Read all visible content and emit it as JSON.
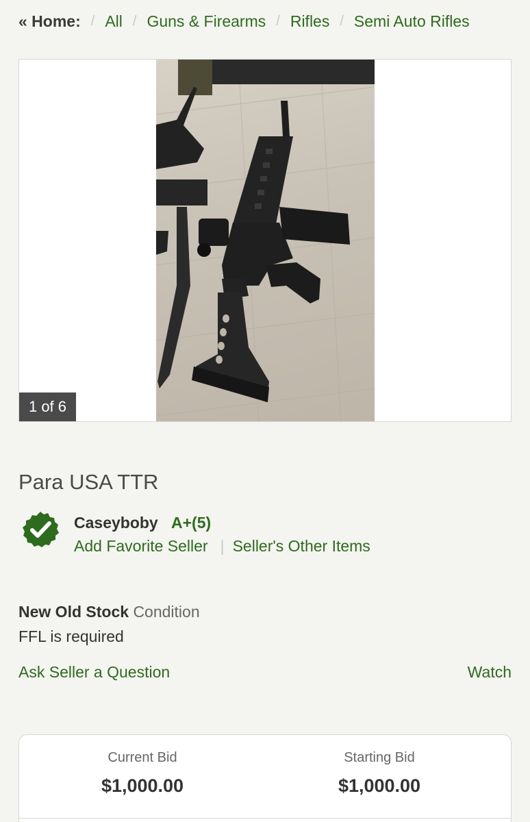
{
  "breadcrumb": {
    "home": "« Home:",
    "items": [
      "All",
      "Guns & Firearms",
      "Rifles",
      "Semi Auto Rifles"
    ],
    "separator": "/"
  },
  "gallery": {
    "counter": "1 of 6"
  },
  "listing": {
    "title": "Para USA TTR"
  },
  "seller": {
    "name": "Caseyboby",
    "rating": "A+(5)",
    "add_favorite": "Add Favorite Seller",
    "other_items": "Seller's Other Items",
    "separator": "|"
  },
  "condition": {
    "value": "New Old Stock",
    "label": "Condition",
    "ffl": "FFL is required"
  },
  "actions": {
    "ask": "Ask Seller a Question",
    "watch": "Watch"
  },
  "bids": {
    "current_label": "Current Bid",
    "current_value": "$1,000.00",
    "starting_label": "Starting Bid",
    "starting_value": "$1,000.00"
  },
  "colors": {
    "accent": "#2e6b1e",
    "background": "#f4f4f0"
  }
}
